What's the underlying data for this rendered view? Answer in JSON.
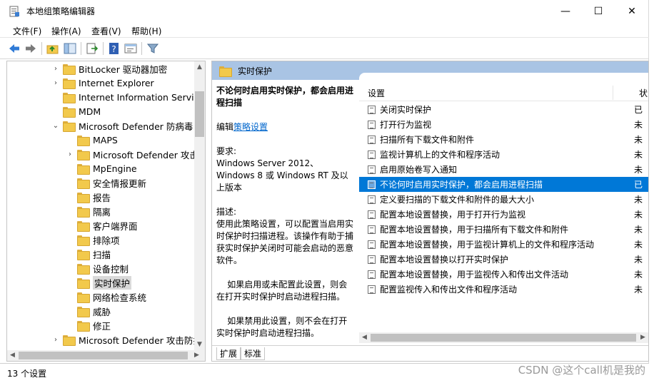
{
  "window": {
    "title": "本地组策略编辑器",
    "minimize": "—",
    "maximize": "☐",
    "close": "✕"
  },
  "menu": [
    "文件(F)",
    "操作(A)",
    "查看(V)",
    "帮助(H)"
  ],
  "tree": {
    "items": [
      {
        "label": "BitLocker 驱动器加密",
        "chev": "›"
      },
      {
        "label": "Internet Explorer",
        "chev": "›"
      },
      {
        "label": "Internet Information Service",
        "chev": ""
      },
      {
        "label": "MDM",
        "chev": ""
      },
      {
        "label": "Microsoft Defender 防病毒",
        "chev": "⌄"
      },
      {
        "label": "MAPS",
        "chev": ""
      },
      {
        "label": "Microsoft Defender 攻击防",
        "chev": "›"
      },
      {
        "label": "MpEngine",
        "chev": ""
      },
      {
        "label": "安全情报更新",
        "chev": ""
      },
      {
        "label": "报告",
        "chev": ""
      },
      {
        "label": "隔离",
        "chev": ""
      },
      {
        "label": "客户端界面",
        "chev": ""
      },
      {
        "label": "排除项",
        "chev": ""
      },
      {
        "label": "扫描",
        "chev": ""
      },
      {
        "label": "设备控制",
        "chev": ""
      },
      {
        "label": "实时保护",
        "chev": ""
      },
      {
        "label": "网络检查系统",
        "chev": ""
      },
      {
        "label": "威胁",
        "chev": ""
      },
      {
        "label": "修正",
        "chev": ""
      },
      {
        "label": "Microsoft Defender 攻击防护",
        "chev": "›"
      }
    ]
  },
  "right": {
    "header": "实时保护",
    "desc": {
      "title": "不论何时启用实时保护，都会启用进程扫描",
      "edit_prefix": "编辑",
      "edit_link": "策略设置",
      "req_label": "要求:",
      "req_text": "Windows Server 2012、Windows 8 或 Windows RT 及以上版本",
      "desc_label": "描述:",
      "desc_text": "使用此策略设置，可以配置当启用实时保护时扫描进程。该操作有助于捕获实时保护关闭时可能会启动的恶意软件。",
      "p1": "如果启用或未配置此设置，则会在打开实时保护时启动进程扫描。",
      "p2": "如果禁用此设置，则不会在打开实时保护时启动进程扫描。"
    },
    "list": {
      "col_setting": "设置",
      "col_state": "状",
      "rows": [
        {
          "name": "关闭实时保护",
          "state": "已"
        },
        {
          "name": "打开行为监视",
          "state": "未"
        },
        {
          "name": "扫描所有下载文件和附件",
          "state": "未"
        },
        {
          "name": "监视计算机上的文件和程序活动",
          "state": "未"
        },
        {
          "name": "启用原始卷写入通知",
          "state": "未"
        },
        {
          "name": "不论何时启用实时保护，都会启用进程扫描",
          "state": "已"
        },
        {
          "name": "定义要扫描的下载文件和附件的最大大小",
          "state": "未"
        },
        {
          "name": "配置本地设置替换，用于打开行为监视",
          "state": "未"
        },
        {
          "name": "配置本地设置替换，用于扫描所有下载文件和附件",
          "state": "未"
        },
        {
          "name": "配置本地设置替换，用于监视计算机上的文件和程序活动",
          "state": "未"
        },
        {
          "name": "配置本地设置替换以打开实时保护",
          "state": "未"
        },
        {
          "name": "配置本地设置替换，用于监视传入和传出文件活动",
          "state": "未"
        },
        {
          "name": "配置监视传入和传出文件和程序活动",
          "state": "未"
        }
      ]
    },
    "tabs": [
      "扩展",
      "标准"
    ]
  },
  "status": {
    "text": "13 个设置"
  },
  "watermark": "CSDN @这个call机是我的"
}
